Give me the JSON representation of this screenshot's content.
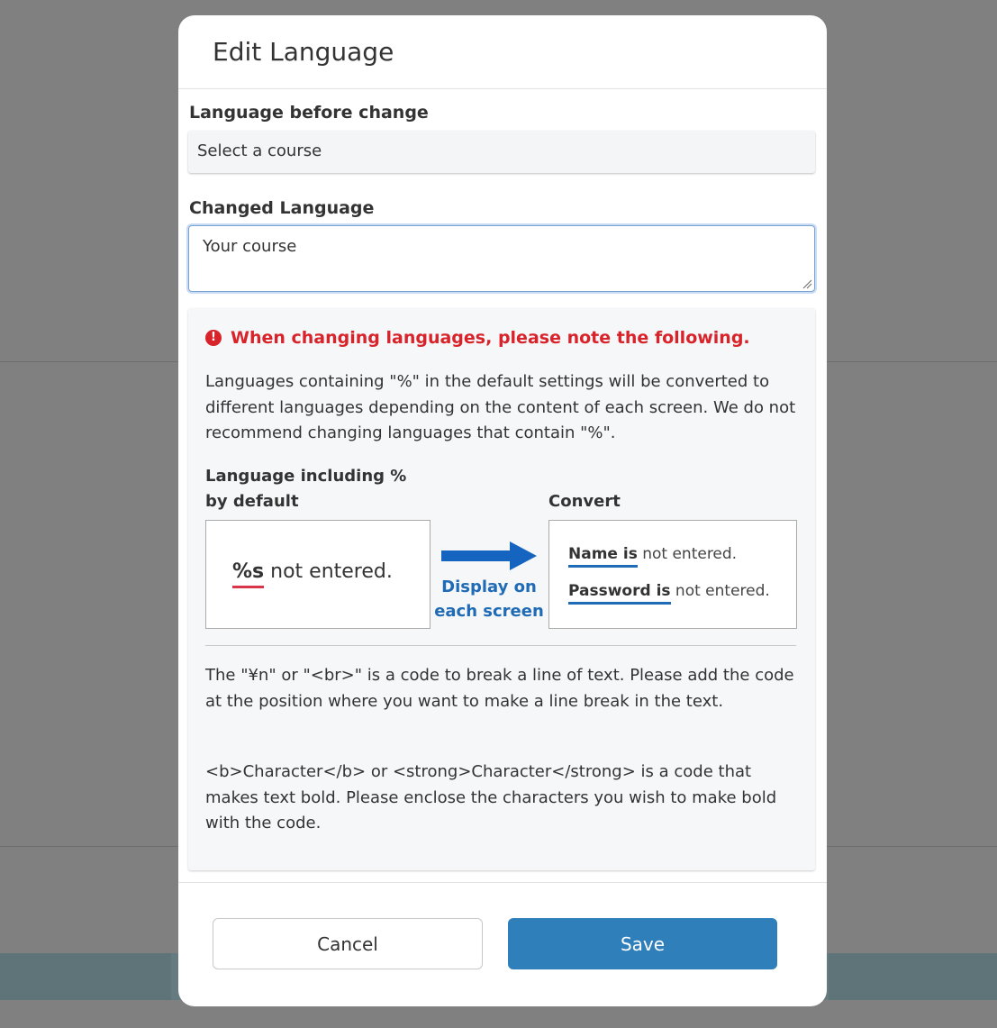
{
  "dialog": {
    "title": "Edit Language"
  },
  "fields": {
    "before_label": "Language before change",
    "before_value": "Select a course",
    "changed_label": "Changed Language",
    "changed_value": "Your course"
  },
  "notice": {
    "warning": "When changing languages, please note the following.",
    "para1": "Languages containing \"%\" in the default settings will be converted to different languages depending on the content of each screen. We do not recommend changing languages that contain \"%\".",
    "default_label_line1": "Language including %",
    "default_label_line2": "by default",
    "convert_label": "Convert",
    "example": {
      "placeholder": "%s",
      "rest": "not entered.",
      "arrow_caption_line1": "Display on",
      "arrow_caption_line2": "each screen",
      "row1_bold": "Name is",
      "row1_rest": "not entered.",
      "row2_bold": "Password is",
      "row2_rest": "not entered."
    },
    "para2": "The \"¥n\" or \"<br>\" is a code to break a line of text. Please add the code at the position where you want to make a line break in the text.",
    "para3": "<b>Character</b> or <strong>Character</strong> is a code that makes text bold. Please enclose the characters you wish to make bold with the code."
  },
  "footer": {
    "cancel_label": "Cancel",
    "save_label": "Save"
  },
  "colors": {
    "accent": "#2f7fbb",
    "warning": "#d8232a",
    "highlight_blue": "#1f6bb5",
    "overlay": "#808080"
  },
  "icons": {
    "warning": "exclamation-circle-icon",
    "arrow": "right-arrow-icon",
    "grip": "resize-grip-icon"
  }
}
